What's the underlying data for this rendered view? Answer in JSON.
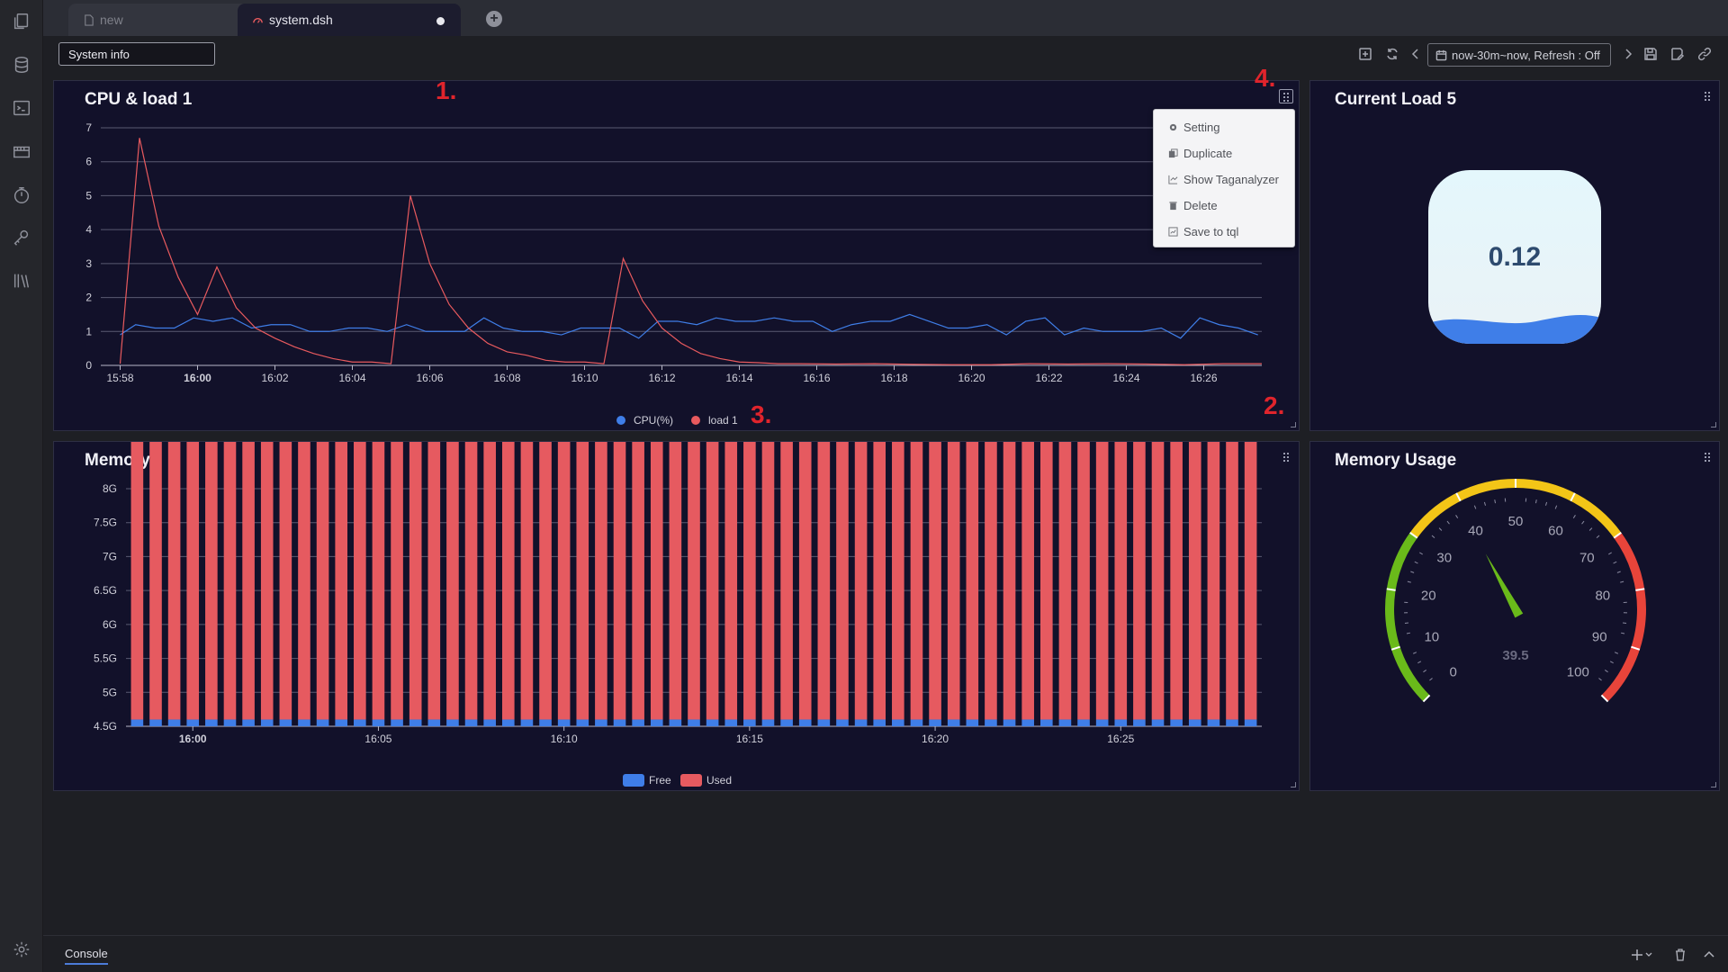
{
  "tabs": {
    "inactive_label": "new",
    "active_label": "system.dsh"
  },
  "toolbar": {
    "dashboard_title": "System info",
    "time_range": "now-30m~now, Refresh : Off"
  },
  "panels": {
    "cpu": {
      "title": "CPU & load 1",
      "menu": [
        "Setting",
        "Duplicate",
        "Show Taganalyzer",
        "Delete",
        "Save to tql"
      ]
    },
    "load5": {
      "title": "Current Load 5",
      "value": "0.12"
    },
    "memory": {
      "title": "Memory"
    },
    "memusage": {
      "title": "Memory Usage",
      "value_label": "39.5"
    }
  },
  "annotations": [
    "1.",
    "2.",
    "3.",
    "4."
  ],
  "console": {
    "tab_label": "Console"
  },
  "colors": {
    "cpu_series": "#3f7ee8",
    "load_series": "#e85a5e",
    "free_series": "#3f7ee8",
    "used_series": "#e65a60",
    "gauge_green": "#6aba1a",
    "gauge_yellow": "#f3c517",
    "gauge_red": "#e8443a"
  },
  "chart_data": [
    {
      "type": "line",
      "title": "CPU & load 1",
      "x_ticks": [
        "15:58",
        "16:00",
        "16:02",
        "16:04",
        "16:06",
        "16:08",
        "16:10",
        "16:12",
        "16:14",
        "16:16",
        "16:18",
        "16:20",
        "16:22",
        "16:24",
        "16:26"
      ],
      "x_range": [
        "15:57.5",
        "16:27.5"
      ],
      "ylim": [
        0,
        7
      ],
      "y_ticks": [
        0,
        1,
        2,
        3,
        4,
        5,
        6,
        7
      ],
      "grid": true,
      "legend": "bottom-center",
      "series": [
        {
          "name": "CPU(%)",
          "x_minutes_after_1557": [
            0.5,
            0.9,
            1.4,
            1.9,
            2.4,
            2.9,
            3.4,
            3.9,
            4.4,
            4.9,
            5.4,
            5.9,
            6.4,
            6.9,
            7.4,
            7.9,
            8.4,
            8.9,
            9.4,
            9.9,
            10.4,
            10.9,
            11.4,
            11.9,
            12.4,
            12.9,
            13.4,
            13.9,
            14.4,
            14.9,
            15.4,
            15.9,
            16.4,
            16.9,
            17.4,
            17.9,
            18.4,
            18.9,
            19.4,
            19.9,
            20.4,
            20.9,
            21.4,
            21.9,
            22.4,
            22.9,
            23.4,
            23.9,
            24.4,
            24.9,
            25.4,
            25.9,
            26.4,
            26.9,
            27.4,
            27.9,
            28.4,
            28.9,
            29.4,
            29.9
          ],
          "values": [
            0.9,
            1.2,
            1.1,
            1.1,
            1.4,
            1.3,
            1.4,
            1.1,
            1.2,
            1.2,
            1.0,
            1.0,
            1.1,
            1.1,
            1.0,
            1.2,
            1.0,
            1.0,
            1.0,
            1.4,
            1.1,
            1.0,
            1.0,
            0.9,
            1.1,
            1.1,
            1.1,
            0.8,
            1.3,
            1.3,
            1.2,
            1.4,
            1.3,
            1.3,
            1.4,
            1.3,
            1.3,
            1.0,
            1.2,
            1.3,
            1.3,
            1.5,
            1.3,
            1.1,
            1.1,
            1.2,
            0.9,
            1.3,
            1.4,
            0.9,
            1.1,
            1.0,
            1.0,
            1.0,
            1.1,
            0.8,
            1.4,
            1.2,
            1.1,
            0.9
          ]
        },
        {
          "name": "load 1",
          "x_minutes_after_1557": [
            0.5,
            1.0,
            1.5,
            2.0,
            2.5,
            3.0,
            3.5,
            4.0,
            4.5,
            5.0,
            5.5,
            6.0,
            6.5,
            7.0,
            7.5,
            8.0,
            8.5,
            9.0,
            9.5,
            10.0,
            10.5,
            11.0,
            11.5,
            12.0,
            12.5,
            13.0,
            13.5,
            14.0,
            14.5,
            15.0,
            15.5,
            16.0,
            16.5,
            17.0,
            17.5,
            18.0,
            19.0,
            20.0,
            21.0,
            22.0,
            23.0,
            24.0,
            25.0,
            26.0,
            27.0,
            28.0,
            29.0,
            30.0
          ],
          "values": [
            0.05,
            6.7,
            4.1,
            2.6,
            1.5,
            2.9,
            1.7,
            1.1,
            0.8,
            0.55,
            0.35,
            0.2,
            0.1,
            0.1,
            0.05,
            5.0,
            3.0,
            1.8,
            1.1,
            0.65,
            0.4,
            0.3,
            0.15,
            0.1,
            0.1,
            0.05,
            3.15,
            1.9,
            1.1,
            0.65,
            0.35,
            0.2,
            0.1,
            0.08,
            0.05,
            0.05,
            0.04,
            0.05,
            0.03,
            0.02,
            0.02,
            0.05,
            0.04,
            0.05,
            0.04,
            0.02,
            0.05,
            0.05
          ]
        }
      ]
    },
    {
      "type": "bar",
      "title": "Memory",
      "stacked": true,
      "x_ticks": [
        "16:00",
        "16:05",
        "16:10",
        "16:15",
        "16:20",
        "16:25"
      ],
      "y_ticks": [
        "4.5G",
        "5G",
        "5.5G",
        "6G",
        "6.5G",
        "7G",
        "7.5G",
        "8G"
      ],
      "ylim_gb": [
        4.5,
        8
      ],
      "bar_count": 61,
      "legend": "bottom-center",
      "series": [
        {
          "name": "Free",
          "value_gb_each_bar": 0.1
        },
        {
          "name": "Used",
          "value_gb_each_bar": 7.78
        }
      ]
    },
    {
      "type": "gauge",
      "title": "Memory Usage",
      "min": 0,
      "max": 100,
      "value": 39.5,
      "tick_labels": [
        0,
        10,
        20,
        30,
        40,
        50,
        60,
        70,
        80,
        90,
        100
      ],
      "bands": [
        {
          "from": 0,
          "to": 30,
          "color": "green"
        },
        {
          "from": 30,
          "to": 70,
          "color": "yellow"
        },
        {
          "from": 70,
          "to": 100,
          "color": "red"
        }
      ]
    },
    {
      "type": "liquid",
      "title": "Current Load 5",
      "value": 0.12
    }
  ]
}
